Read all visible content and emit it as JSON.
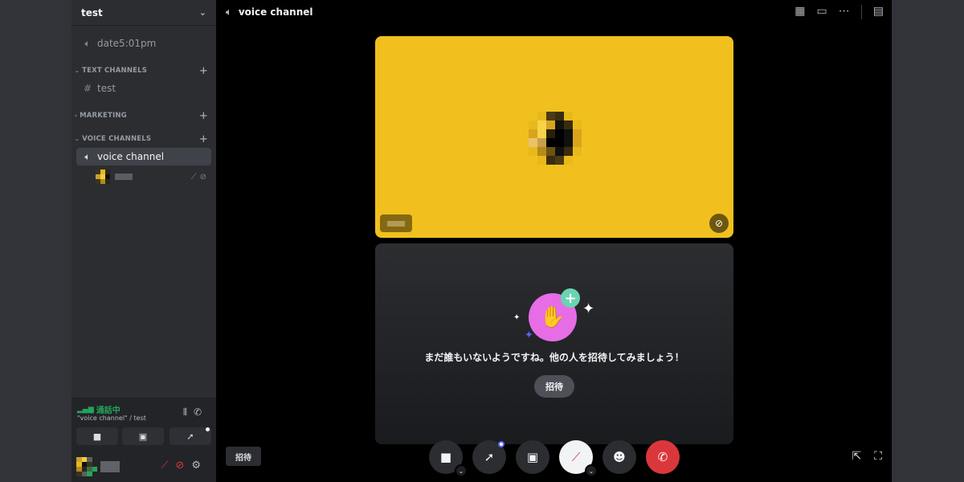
{
  "server": {
    "name": "test"
  },
  "sidebar": {
    "event_channel": "date5:01pm",
    "categories": [
      {
        "label": "TEXT CHANNELS"
      },
      {
        "label": "MARKETING"
      },
      {
        "label": "VOICE CHANNELS"
      }
    ],
    "text_channel": "test",
    "voice_channel": "voice channel"
  },
  "voice_status": {
    "label": "通話中",
    "subtitle": "\"voice channel\" / test"
  },
  "topbar": {
    "title": "voice channel"
  },
  "invite_tile": {
    "message": "まだ誰もいないようですね。他の人を招待してみましょう！",
    "button_label": "招待"
  },
  "bottom": {
    "invite_label": "招待"
  },
  "colors": {
    "connected_green": "#23a559",
    "hangup_red": "#da373c",
    "tile_yellow": "#f1c01f",
    "invite_pink": "#e66de6"
  }
}
